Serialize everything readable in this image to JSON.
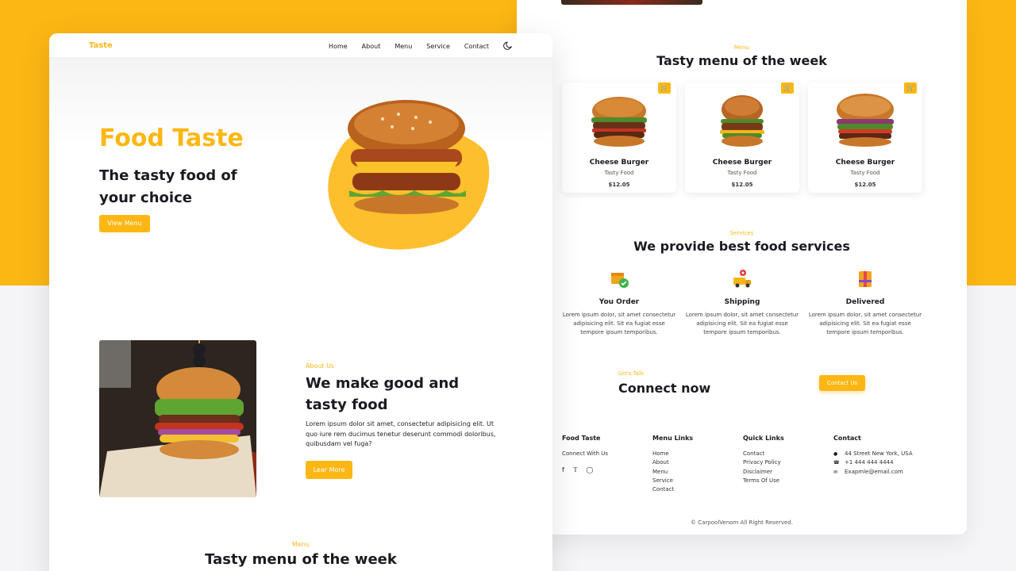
{
  "left": {
    "logo": "Taste",
    "nav": [
      "Home",
      "About",
      "Menu",
      "Service",
      "Contact"
    ],
    "hero": {
      "title": "Food Taste",
      "subtitle": "The tasty food of your choice",
      "button": "View Menu"
    },
    "about": {
      "eyebrow": "About Us",
      "title": "We make good and tasty food",
      "text": "Lorem ipsum dolor sit amet, consectetur adipisicing elit. Ut quo iure rem ducimus tenetur deserunt commodi doloribus, quibusdam vel fuga?",
      "button": "Lear More"
    },
    "menu": {
      "eyebrow": "Menu",
      "title": "Tasty menu of the week"
    }
  },
  "right": {
    "menu": {
      "eyebrow": "Menu",
      "title": "Tasty menu of the week",
      "cards": [
        {
          "name": "Cheese Burger",
          "sub": "Tasty Food",
          "price": "$12.05"
        },
        {
          "name": "Cheese Burger",
          "sub": "Tasty Food",
          "price": "$12.05"
        },
        {
          "name": "Cheese Burger",
          "sub": "Tasty Food",
          "price": "$12.05"
        }
      ]
    },
    "services": {
      "eyebrow": "Services",
      "title": "We provide best food services",
      "items": [
        {
          "name": "You Order",
          "icon": "order-box-icon",
          "text": "Lorem ipsum dolor, sit amet consectetur adipisicing elit. Sit ea fugiat esse tempore ipsum temporibus."
        },
        {
          "name": "Shipping",
          "icon": "delivery-truck-icon",
          "text": "Lorem ipsum dolor, sit amet consectetur adipisicing elit. Sit ea fugiat esse tempore ipsum temporibus."
        },
        {
          "name": "Delivered",
          "icon": "delivered-package-icon",
          "text": "Lorem ipsum dolor, sit amet consectetur adipisicing elit. Sit ea fugiat esse tempore ipsum temporibus."
        }
      ]
    },
    "connect": {
      "eyebrow": "Let's Talk",
      "title": "Connect now",
      "button": "Contact Us"
    },
    "footer": {
      "brand": {
        "title": "Food Taste",
        "text": "Connect With Us"
      },
      "social": [
        "f",
        "t",
        "ig"
      ],
      "menu_links": {
        "title": "Menu Links",
        "links": [
          "Home",
          "About",
          "Menu",
          "Service",
          "Contact"
        ]
      },
      "quick_links": {
        "title": "Quick Links",
        "links": [
          "Contact",
          "Privacy Policy",
          "Disclaimer",
          "Terms Of Use"
        ]
      },
      "contact": {
        "title": "Contact",
        "address": "44 Street New York, USA",
        "phone": "+1 444 444 4444",
        "email": "Exapmle@email.com"
      },
      "copyright": "© CarpoolVenom All Right Reserved."
    }
  },
  "colors": {
    "accent": "#fdb714",
    "text": "#1a1a22",
    "background": "#f5f5f7"
  }
}
